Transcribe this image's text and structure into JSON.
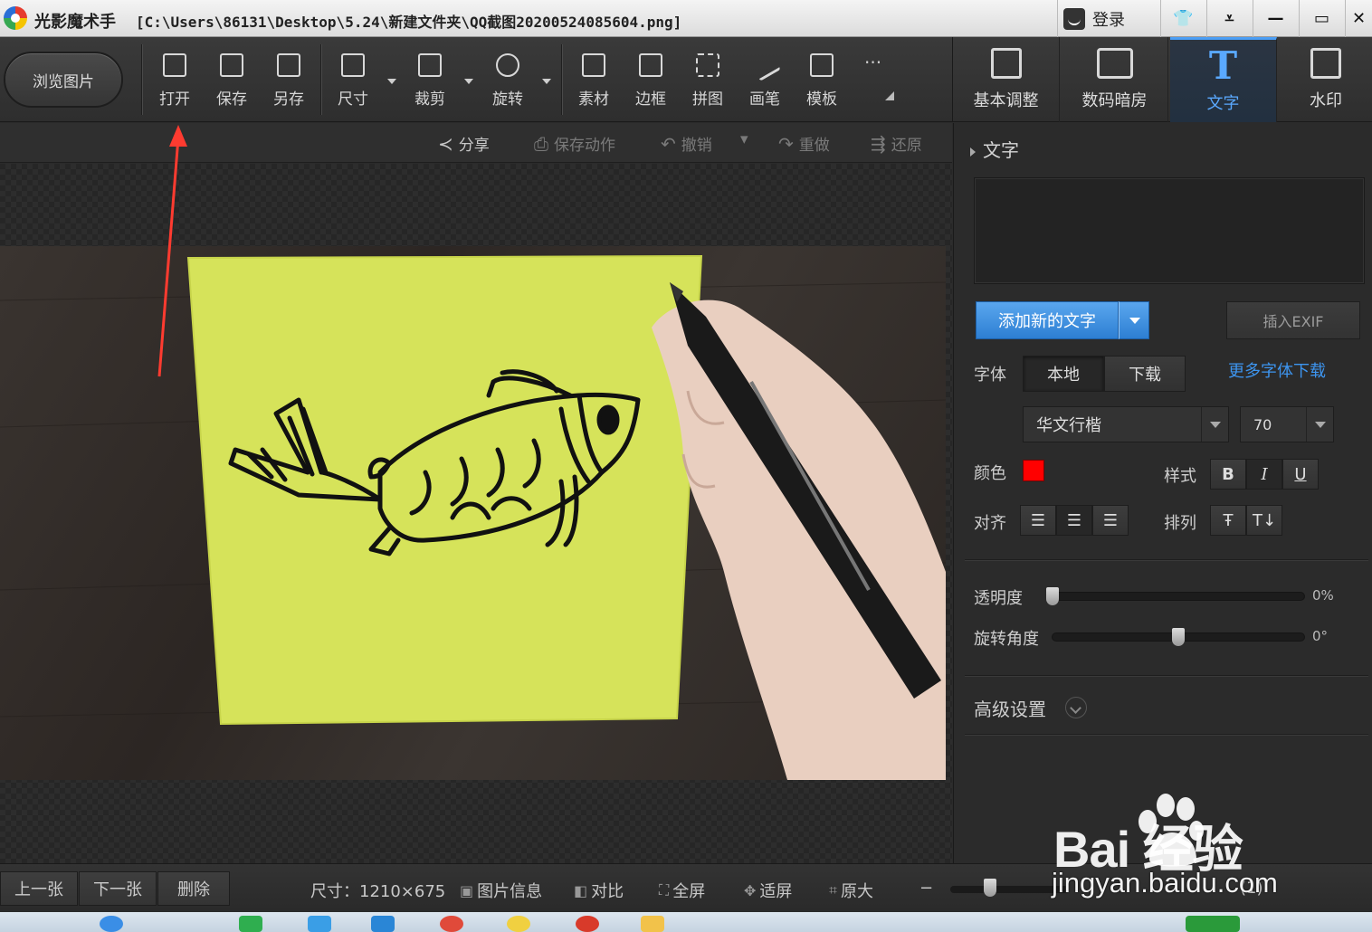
{
  "window": {
    "app_name": "光影魔术手",
    "file_path": "[C:\\Users\\86131\\Desktop\\5.24\\新建文件夹\\QQ截图20200524085604.png]",
    "login_label": "登录",
    "controls": [
      "tshirt-icon",
      "menu-icon",
      "minimize-icon",
      "maximize-icon",
      "close-icon"
    ]
  },
  "toolbar": {
    "browse_label": "浏览图片",
    "tools": [
      {
        "label": "打开",
        "icon": "open-image-icon"
      },
      {
        "label": "保存",
        "icon": "save-icon"
      },
      {
        "label": "另存",
        "icon": "save-as-icon"
      },
      {
        "label": "尺寸",
        "icon": "resize-icon"
      },
      {
        "label": "裁剪",
        "icon": "crop-icon"
      },
      {
        "label": "旋转",
        "icon": "rotate-icon"
      },
      {
        "label": "素材",
        "icon": "material-icon"
      },
      {
        "label": "边框",
        "icon": "border-icon"
      },
      {
        "label": "拼图",
        "icon": "collage-icon"
      },
      {
        "label": "画笔",
        "icon": "brush-icon"
      },
      {
        "label": "模板",
        "icon": "template-icon"
      }
    ],
    "more_glyph": "···"
  },
  "right_tabs": [
    {
      "label": "基本调整",
      "icon": "basic-adjust-icon"
    },
    {
      "label": "数码暗房",
      "icon": "darkroom-icon"
    },
    {
      "label": "文字",
      "icon": "text-icon",
      "active": true,
      "glyph": "T"
    },
    {
      "label": "水印",
      "icon": "watermark-icon"
    }
  ],
  "actions": {
    "share": "分享",
    "save_action": "保存动作",
    "undo": "撤销",
    "redo": "重做",
    "restore": "还原"
  },
  "text_panel": {
    "title": "文字",
    "add_text_label": "添加新的文字",
    "insert_exif_label": "插入EXIF",
    "font_label": "字体",
    "font_source_local": "本地",
    "font_source_download": "下载",
    "more_fonts_label": "更多字体下载",
    "font_name": "华文行楷",
    "font_size": "70",
    "color_label": "颜色",
    "color_value": "#ff0000",
    "style_label": "样式",
    "style_bold": "B",
    "style_italic": "I",
    "style_underline": "U",
    "align_label": "对齐",
    "arrange_label": "排列",
    "opacity_label": "透明度",
    "opacity_value": "0%",
    "opacity_level": 0,
    "rotation_label": "旋转角度",
    "rotation_value": "0°",
    "rotation_level": 0.5,
    "advanced_label": "高级设置"
  },
  "statusbar": {
    "prev_label": "上一张",
    "next_label": "下一张",
    "delete_label": "删除",
    "size_text": "尺寸：1210×675",
    "info_label": "图片信息",
    "compare_label": "对比",
    "fullscreen_label": "全屏",
    "fit_label": "适屏",
    "original_label": "原大",
    "zoom_text": "(1)"
  },
  "watermark": {
    "brand": "Bai  经验",
    "url": "jingyan.baidu.com"
  },
  "colors": {
    "accent": "#4b9ef5",
    "link": "#3d95f0",
    "annotation_arrow": "#ff3b30",
    "sticky_note": "#d6e35a"
  }
}
